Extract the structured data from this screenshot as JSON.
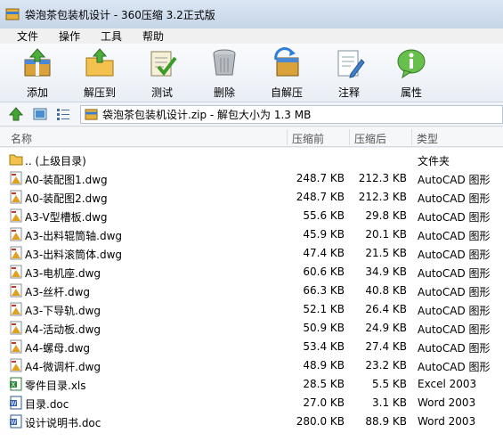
{
  "window": {
    "title": "袋泡茶包装机设计 - 360压缩 3.2正式版"
  },
  "menu": [
    {
      "label": "文件"
    },
    {
      "label": "操作"
    },
    {
      "label": "工具"
    },
    {
      "label": "帮助"
    }
  ],
  "toolbar": [
    {
      "label": "添加",
      "icon": "add-icon"
    },
    {
      "label": "解压到",
      "icon": "extract-to-icon"
    },
    {
      "label": "测试",
      "icon": "test-icon"
    },
    {
      "label": "删除",
      "icon": "delete-icon"
    },
    {
      "label": "自解压",
      "icon": "self-extract-icon"
    },
    {
      "label": "注释",
      "icon": "comment-icon"
    },
    {
      "label": "属性",
      "icon": "info-icon"
    }
  ],
  "address": {
    "text": "袋泡茶包装机设计.zip - 解包大小为 1.3 MB"
  },
  "columns": {
    "name": "名称",
    "packed": "压缩前",
    "size": "压缩后",
    "type": "类型"
  },
  "files": [
    {
      "name": ".. (上级目录)",
      "packed": "",
      "size": "",
      "type": "文件夹",
      "icon": "folder-icon"
    },
    {
      "name": "A0-装配图1.dwg",
      "packed": "248.7 KB",
      "size": "212.3 KB",
      "type": "AutoCAD 图形",
      "icon": "dwg-file-icon"
    },
    {
      "name": "A0-装配图2.dwg",
      "packed": "248.7 KB",
      "size": "212.3 KB",
      "type": "AutoCAD 图形",
      "icon": "dwg-file-icon"
    },
    {
      "name": "A3-V型槽板.dwg",
      "packed": "55.6 KB",
      "size": "29.8 KB",
      "type": "AutoCAD 图形",
      "icon": "dwg-file-icon"
    },
    {
      "name": "A3-出料辊筒轴.dwg",
      "packed": "45.9 KB",
      "size": "20.1 KB",
      "type": "AutoCAD 图形",
      "icon": "dwg-file-icon"
    },
    {
      "name": "A3-出料滚筒体.dwg",
      "packed": "47.4 KB",
      "size": "21.5 KB",
      "type": "AutoCAD 图形",
      "icon": "dwg-file-icon"
    },
    {
      "name": "A3-电机座.dwg",
      "packed": "60.6 KB",
      "size": "34.9 KB",
      "type": "AutoCAD 图形",
      "icon": "dwg-file-icon"
    },
    {
      "name": "A3-丝杆.dwg",
      "packed": "66.3 KB",
      "size": "40.8 KB",
      "type": "AutoCAD 图形",
      "icon": "dwg-file-icon"
    },
    {
      "name": "A3-下导轨.dwg",
      "packed": "52.1 KB",
      "size": "26.4 KB",
      "type": "AutoCAD 图形",
      "icon": "dwg-file-icon"
    },
    {
      "name": "A4-活动板.dwg",
      "packed": "50.9 KB",
      "size": "24.9 KB",
      "type": "AutoCAD 图形",
      "icon": "dwg-file-icon"
    },
    {
      "name": "A4-螺母.dwg",
      "packed": "53.4 KB",
      "size": "27.4 KB",
      "type": "AutoCAD 图形",
      "icon": "dwg-file-icon"
    },
    {
      "name": "A4-微调杆.dwg",
      "packed": "48.9 KB",
      "size": "23.2 KB",
      "type": "AutoCAD 图形",
      "icon": "dwg-file-icon"
    },
    {
      "name": "零件目录.xls",
      "packed": "28.5 KB",
      "size": "5.5 KB",
      "type": "Excel 2003",
      "icon": "xls-file-icon"
    },
    {
      "name": "目录.doc",
      "packed": "27.0 KB",
      "size": "3.1 KB",
      "type": "Word 2003",
      "icon": "doc-file-icon"
    },
    {
      "name": "设计说明书.doc",
      "packed": "280.0 KB",
      "size": "88.9 KB",
      "type": "Word 2003",
      "icon": "doc-file-icon"
    }
  ]
}
